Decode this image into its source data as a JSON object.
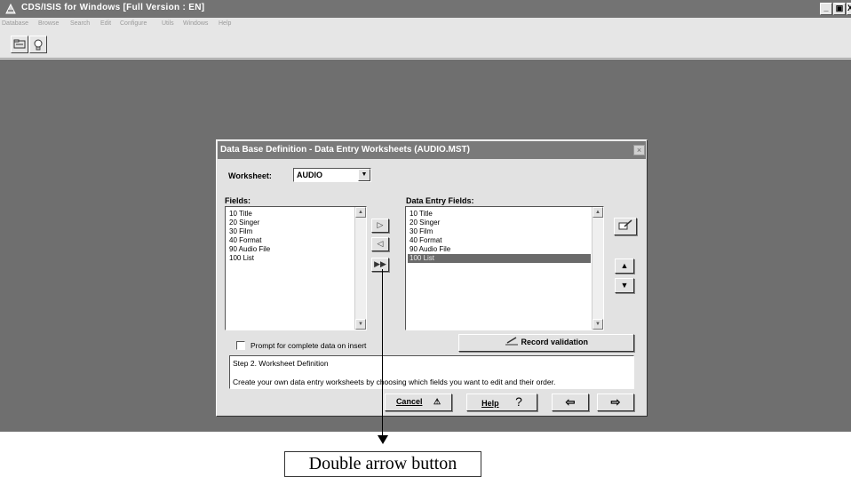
{
  "window": {
    "title": "CDS/ISIS for Windows [Full Version : EN]",
    "controls": {
      "minimize": "_",
      "maximize": "▣",
      "close": "X"
    }
  },
  "menu": [
    "Database",
    "Browse",
    "Search",
    "Edit",
    "Configure",
    "Utils",
    "Windows",
    "Help"
  ],
  "toolbar": {
    "icons": [
      "open-database-icon",
      "lightbulb-icon"
    ]
  },
  "dialog": {
    "title": "Data Base Definition - Data Entry Worksheets (AUDIO.MST)",
    "close": "×",
    "worksheet_label": "Worksheet:",
    "worksheet_value": "AUDIO",
    "fields_label": "Fields:",
    "fields": [
      "10 Title",
      "20 Singer",
      "30 Film",
      "40 Format",
      "90 Audio File",
      "100 List"
    ],
    "entry_label": "Data Entry Fields:",
    "entry_fields": [
      "10 Title",
      "20 Singer",
      "30 Film",
      "40 Format",
      "90 Audio File",
      "100 List"
    ],
    "selected_entry": "100 List",
    "prompt_label": "Prompt for complete data on insert",
    "prompt_checked": false,
    "record_validation": "Record validation",
    "step_title": "Step 2. Worksheet Definition",
    "step_text": "Create your own data entry worksheets by choosing which fields you want to edit and their order.",
    "cancel": "Cancel",
    "help": "Help",
    "help_mark": "?",
    "back_arrow": "⇦",
    "next_arrow": "⇨"
  },
  "annotation": {
    "caption": "Double arrow button"
  }
}
